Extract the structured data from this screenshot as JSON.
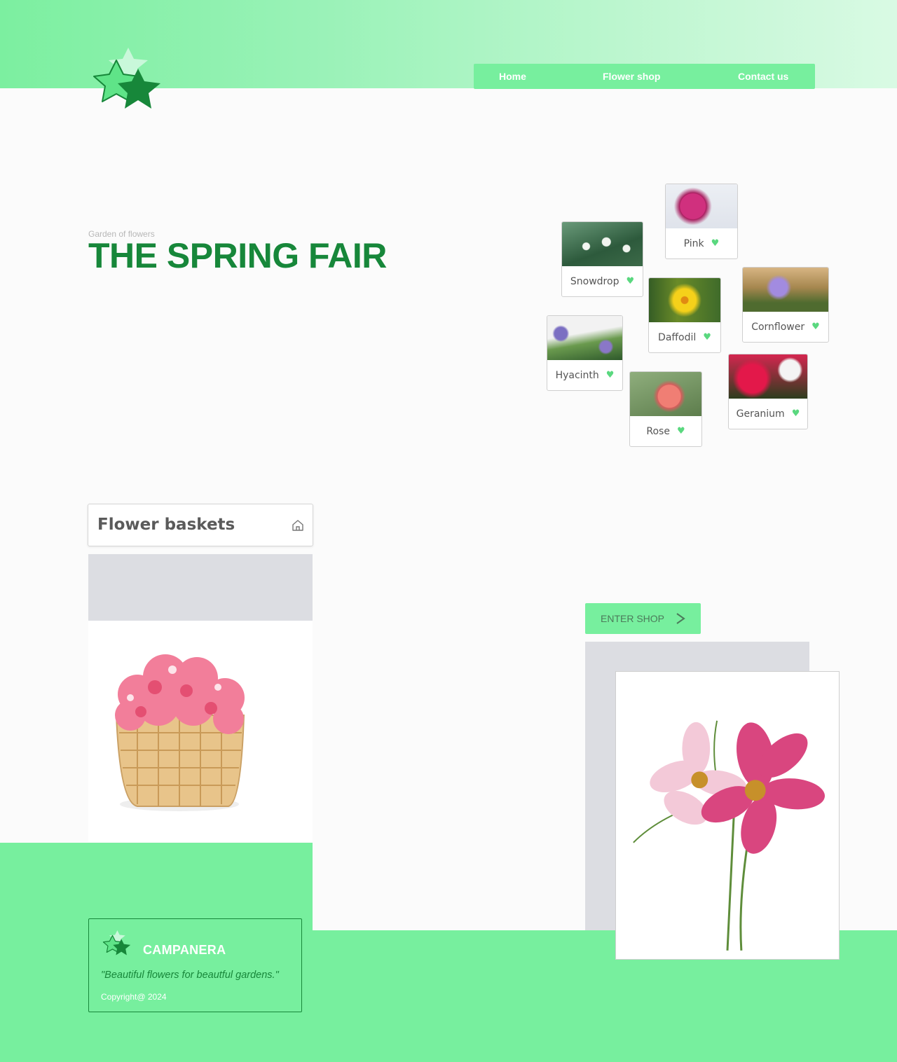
{
  "nav": {
    "items": [
      "Home",
      "Flower shop",
      "Contact us"
    ]
  },
  "hero": {
    "kicker": "Garden of flowers",
    "title": "THE SPRING FAIR"
  },
  "flowers": [
    "Snowdrop",
    "Pink",
    "Daffodil",
    "Cornflower",
    "Hyacinth",
    "Rose",
    "Geranium"
  ],
  "baskets": {
    "title": "Flower baskets"
  },
  "shop": {
    "button_label": "ENTER SHOP"
  },
  "footer": {
    "brand": "CAMPANERA",
    "tagline": "\"Beautiful flowers for beautful gardens.\"",
    "copyright": "Copyright@  2024"
  },
  "colors": {
    "primary": "#77ef9e",
    "dark_green": "#17873a",
    "heart": "#5ad87f"
  },
  "icons": {
    "logo": "star-logo-icon",
    "heart": "heart-icon",
    "home": "home-icon",
    "arrow": "chevron-right-icon"
  }
}
